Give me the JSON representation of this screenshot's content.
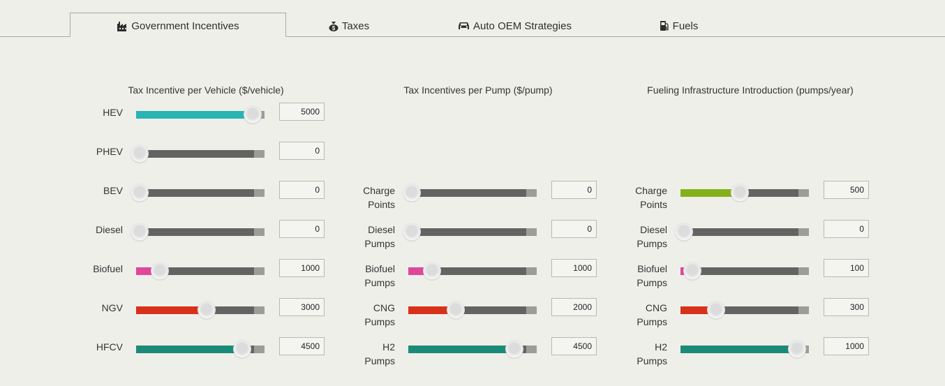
{
  "tabs": [
    {
      "label": "Government Incentives",
      "icon": "factory-icon",
      "active": true
    },
    {
      "label": "Taxes",
      "icon": "money-bag-icon",
      "active": false
    },
    {
      "label": "Auto OEM Strategies",
      "icon": "car-icon",
      "active": false
    },
    {
      "label": "Fuels",
      "icon": "fuel-pump-icon",
      "active": false
    }
  ],
  "columns": [
    {
      "title": "Tax Incentive per Vehicle ($/vehicle)",
      "rows": [
        {
          "label": [
            "HEV"
          ],
          "value": "5000",
          "fraction": 1.0,
          "color": "#2ab3b3"
        },
        {
          "label": [
            "PHEV"
          ],
          "value": "0",
          "fraction": 0.0,
          "color": "#2ab3b3"
        },
        {
          "label": [
            "BEV"
          ],
          "value": "0",
          "fraction": 0.0,
          "color": "#2ab3b3"
        },
        {
          "label": [
            "Diesel"
          ],
          "value": "0",
          "fraction": 0.0,
          "color": "#2ab3b3"
        },
        {
          "label": [
            "Biofuel"
          ],
          "value": "1000",
          "fraction": 0.2,
          "color": "#e0469a"
        },
        {
          "label": [
            "NGV"
          ],
          "value": "3000",
          "fraction": 0.6,
          "color": "#d9301a"
        },
        {
          "label": [
            "HFCV"
          ],
          "value": "4500",
          "fraction": 0.9,
          "color": "#1c8a78"
        }
      ]
    },
    {
      "title": "Tax Incentives per Pump ($/pump)",
      "rows": [
        {
          "label": [
            "Charge",
            "Points"
          ],
          "value": "0",
          "fraction": 0.0,
          "color": "#7aa81e"
        },
        {
          "label": [
            "Diesel",
            "Pumps"
          ],
          "value": "0",
          "fraction": 0.0,
          "color": "#7aa81e"
        },
        {
          "label": [
            "Biofuel",
            "Pumps"
          ],
          "value": "1000",
          "fraction": 0.2,
          "color": "#e0469a"
        },
        {
          "label": [
            "CNG",
            "Pumps"
          ],
          "value": "2000",
          "fraction": 0.4,
          "color": "#d9301a"
        },
        {
          "label": [
            "H2",
            "Pumps"
          ],
          "value": "4500",
          "fraction": 0.9,
          "color": "#1c8a78"
        }
      ]
    },
    {
      "title": "Fueling Infrastructure Introduction (pumps/year)",
      "rows": [
        {
          "label": [
            "Charge",
            "Points"
          ],
          "value": "500",
          "fraction": 0.5,
          "color": "#84b01a"
        },
        {
          "label": [
            "Diesel",
            "Pumps"
          ],
          "value": "0",
          "fraction": 0.0,
          "color": "#84b01a"
        },
        {
          "label": [
            "Biofuel",
            "Pumps"
          ],
          "value": "100",
          "fraction": 0.1,
          "color": "#e0469a"
        },
        {
          "label": [
            "CNG",
            "Pumps"
          ],
          "value": "300",
          "fraction": 0.3,
          "color": "#d9301a"
        },
        {
          "label": [
            "H2",
            "Pumps"
          ],
          "value": "1000",
          "fraction": 1.0,
          "color": "#1c8a78"
        }
      ]
    }
  ]
}
